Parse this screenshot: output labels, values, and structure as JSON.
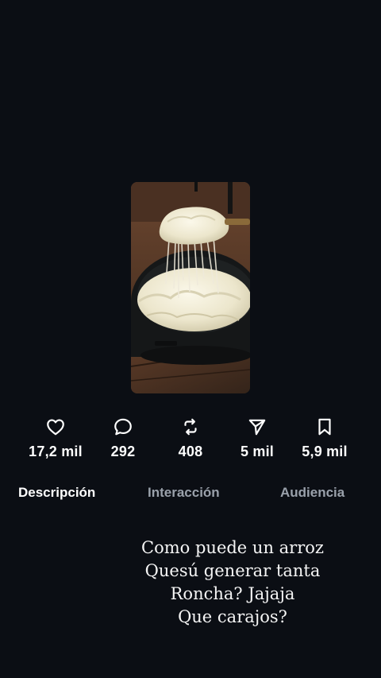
{
  "post": {
    "media": {
      "description_icon": "cheese-rice-photo",
      "colors": {
        "background": "#0b0e14",
        "pan": "#161819",
        "cheese": "#ece8d2",
        "table": "#5a3a26"
      }
    }
  },
  "stats": [
    {
      "icon": "heart-icon",
      "count": "17,2 mil"
    },
    {
      "icon": "comment-icon",
      "count": "292"
    },
    {
      "icon": "repost-icon",
      "count": "408"
    },
    {
      "icon": "share-icon",
      "count": "5 mil"
    },
    {
      "icon": "bookmark-icon",
      "count": "5,9 mil"
    }
  ],
  "tabs": [
    {
      "label": "Descripción",
      "active": true
    },
    {
      "label": "Interacción",
      "active": false
    },
    {
      "label": "Audiencia",
      "active": false
    }
  ],
  "caption": {
    "lines": [
      "Como puede un arroz",
      "Quesú generar tanta",
      "Roncha? Jajaja",
      "Que carajos?"
    ]
  }
}
